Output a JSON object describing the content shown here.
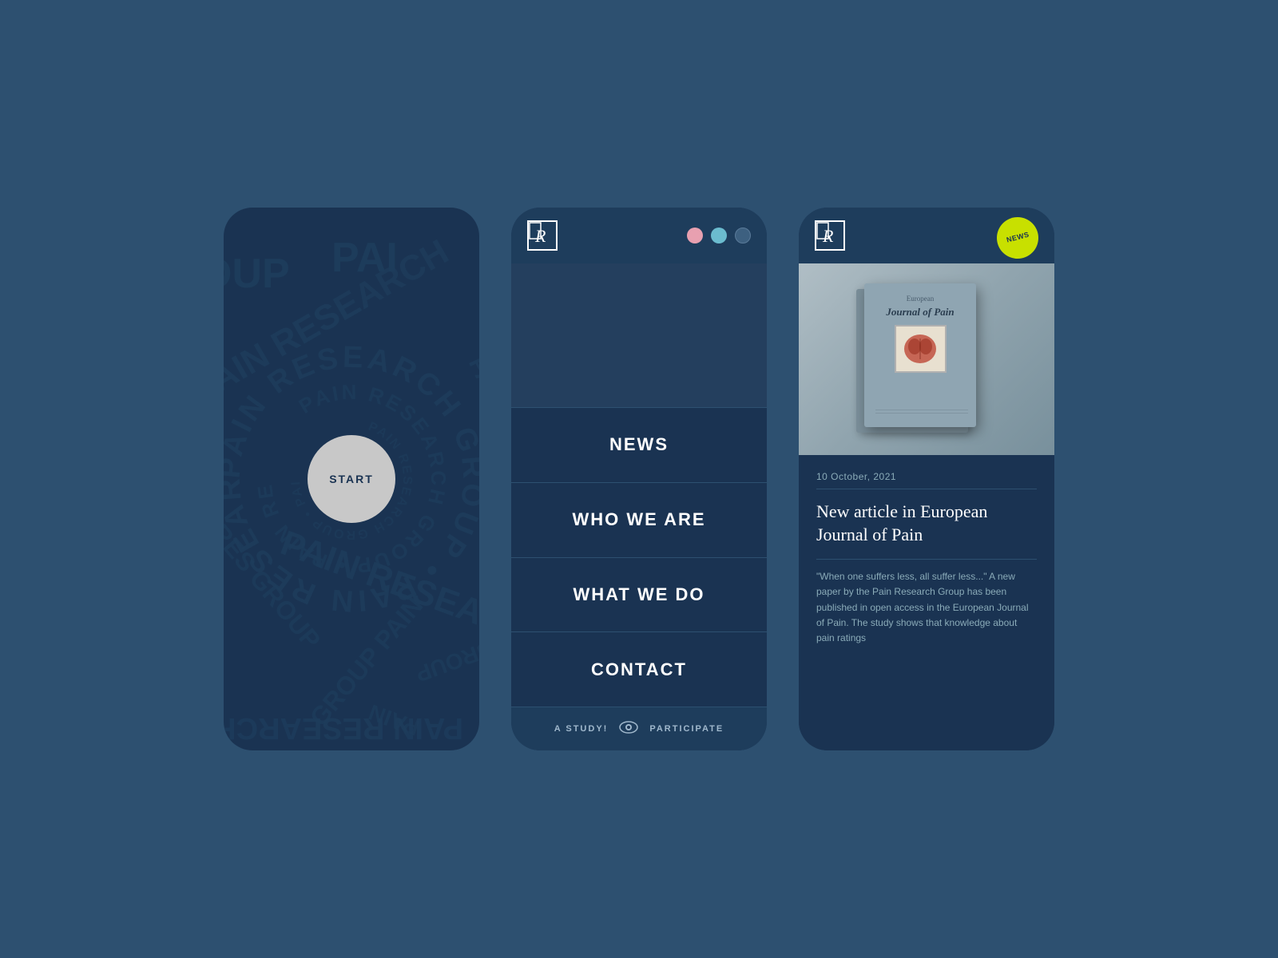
{
  "background": "#2d5070",
  "phone1": {
    "start_label": "START",
    "circular_text": "PAIN RESEARCH GROUP"
  },
  "phone2": {
    "logo_alt": "Pain Research Group Logo",
    "dots": [
      {
        "color": "#e8a0b0",
        "name": "pink"
      },
      {
        "color": "#6bbccf",
        "name": "teal"
      },
      {
        "color": "#3d6080",
        "name": "dark"
      }
    ],
    "nav_items": [
      "NEWS",
      "WHO WE ARE",
      "WHAT WE DO",
      "CONTACT"
    ],
    "footer_left": "A STUDY!",
    "footer_right": "PARTICIPATE"
  },
  "phone3": {
    "logo_alt": "Pain Research Group Logo",
    "news_badge": "NEWS",
    "article_date": "10 October, 2021",
    "article_title": "New article in European Journal of Pain",
    "article_excerpt": "\"When one suffers less, all suffer less...\" A new paper by the Pain Research Group has been published in open access in the European Journal of Pain. The study shows that knowledge about pain ratings",
    "journal_title": "Journal of Pain"
  }
}
